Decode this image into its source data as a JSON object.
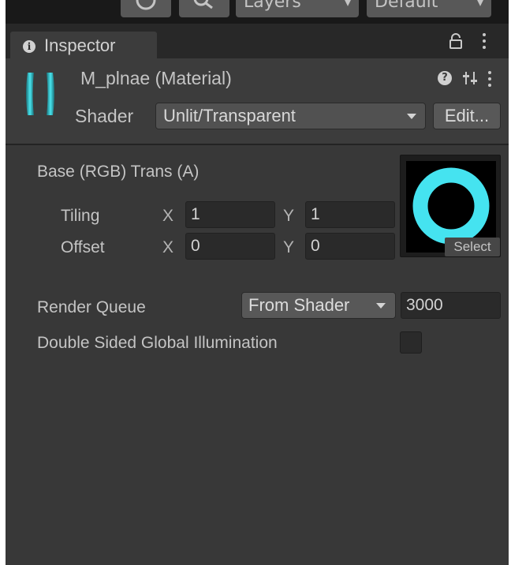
{
  "toolbar": {
    "layers_label": "Layers",
    "layout_label": "Default"
  },
  "tab": {
    "title": "Inspector"
  },
  "material": {
    "title": "M_plnae (Material)",
    "shader_label": "Shader",
    "shader_value": "Unlit/Transparent",
    "edit_label": "Edit..."
  },
  "properties": {
    "texture_label": "Base (RGB) Trans (A)",
    "tiling_label": "Tiling",
    "offset_label": "Offset",
    "x_label": "X",
    "y_label": "Y",
    "tiling_x": "1",
    "tiling_y": "1",
    "offset_x": "0",
    "offset_y": "0",
    "select_label": "Select",
    "render_queue_label": "Render Queue",
    "render_queue_mode": "From Shader",
    "render_queue_value": "3000",
    "double_sided_gi_label": "Double Sided Global Illumination",
    "double_sided_gi_checked": false
  },
  "colors": {
    "panel_bg": "#383838",
    "header_bg": "#3c3c3c",
    "texture_ring": "#45e3f0",
    "material_icon": "#3fd0d8"
  },
  "icons": {
    "toolbar_history": "history-icon",
    "toolbar_search": "search-icon",
    "tab": "info-icon",
    "lock": "lock-icon",
    "menu": "kebab-menu-icon",
    "help": "help-icon",
    "presets": "preset-sliders-icon",
    "material": "material-preview-icon",
    "dropdown": "dropdown-arrow-icon"
  }
}
